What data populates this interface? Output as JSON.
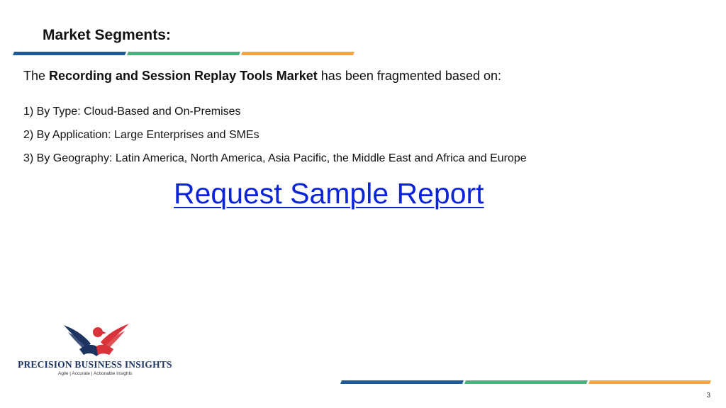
{
  "slide": {
    "title": "Market Segments:",
    "intro_prefix": "The ",
    "intro_bold": "Recording and Session Replay Tools Market",
    "intro_suffix": " has been fragmented based on:",
    "segments": [
      "1) By Type: Cloud-Based and On-Premises",
      "2) By Application: Large Enterprises and SMEs",
      "3) By Geography: Latin America, North America, Asia Pacific, the Middle East and Africa and Europe"
    ],
    "cta_label": "Request Sample Report",
    "page_number": "3"
  },
  "logo": {
    "name": "PRECISION BUSINESS INSIGHTS",
    "tagline": "Agile | Accurate | Actionable Insights"
  },
  "colors": {
    "blue": "#1f5a96",
    "green": "#4caf7d",
    "orange": "#f5a54a",
    "link": "#0b24d8",
    "logo_navy": "#1d3461",
    "logo_red": "#d9323a"
  }
}
